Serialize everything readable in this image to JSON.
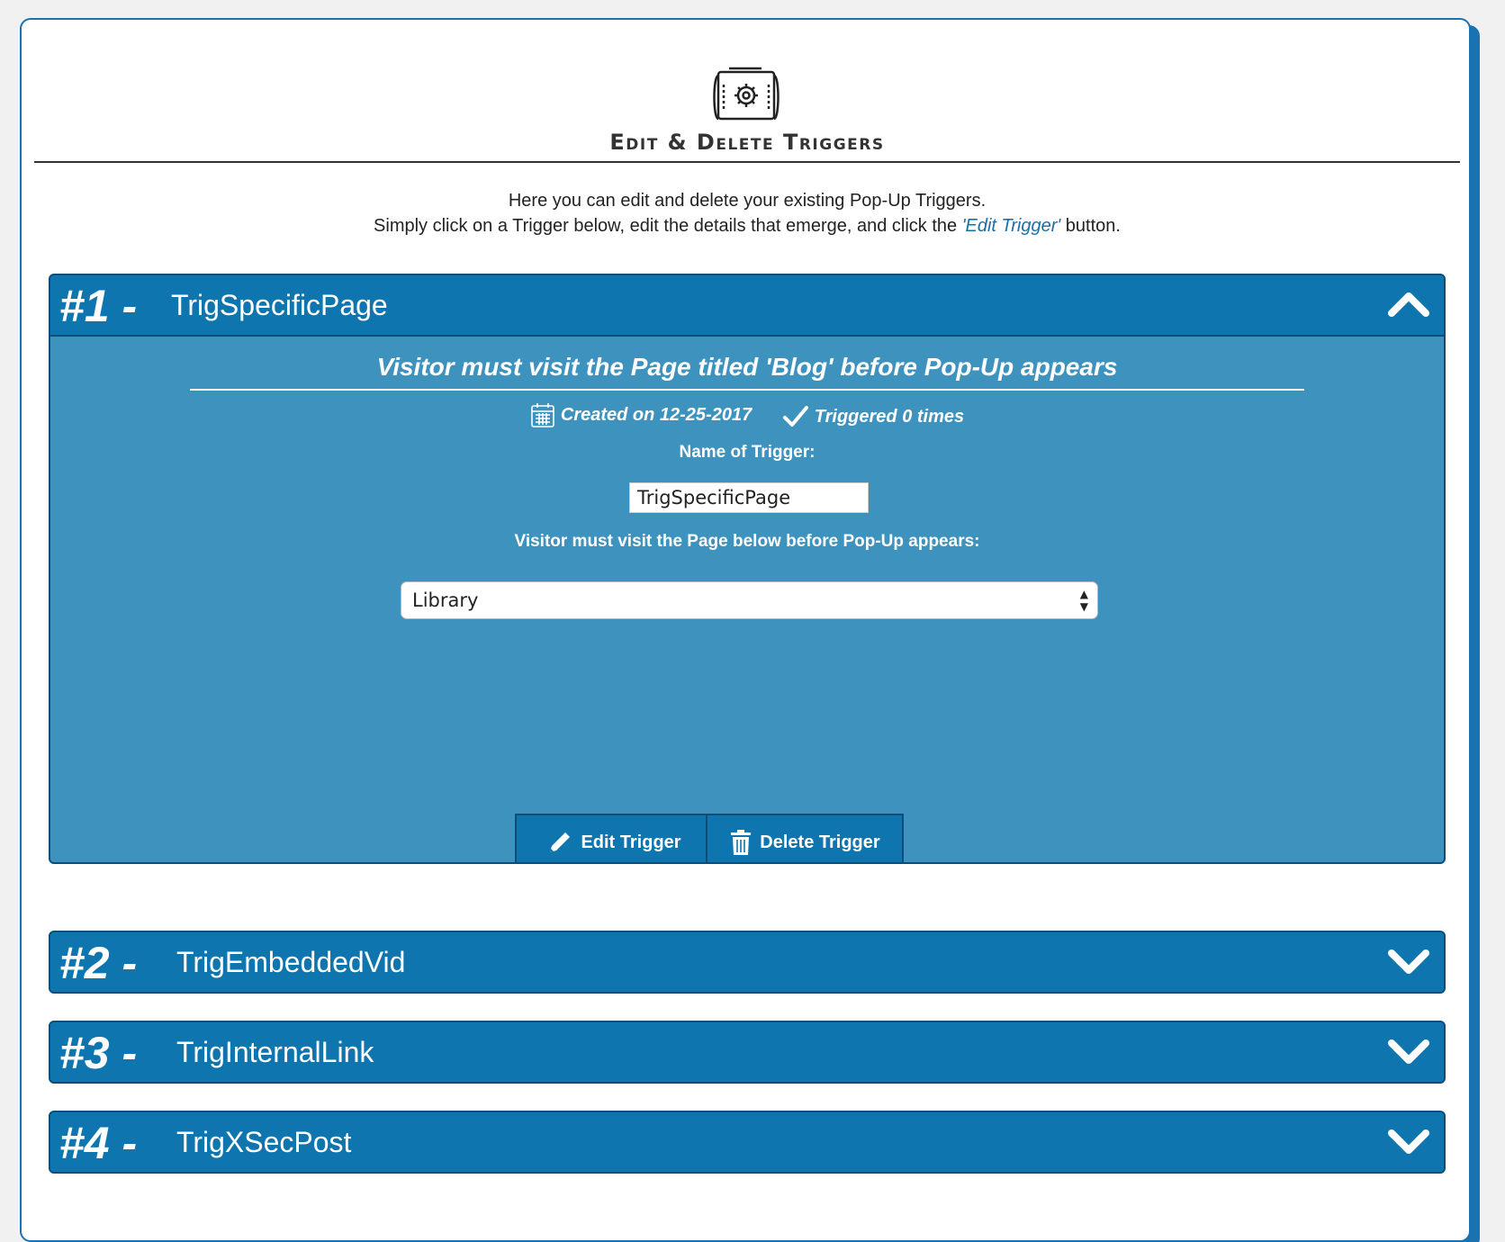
{
  "page": {
    "title": "Edit & Delete Triggers",
    "intro_line1": "Here you can edit and delete your existing Pop-Up Triggers.",
    "intro_line2_pre": "Simply click on a Trigger below, edit the details that emerge, and click the ",
    "intro_line2_em": "'Edit Trigger'",
    "intro_line2_post": " button."
  },
  "triggers": [
    {
      "number": "#1 -",
      "name": "TrigSpecificPage",
      "expanded": true,
      "description": "Visitor must visit the Page titled 'Blog' before Pop-Up appears",
      "created": "Created on 12-25-2017",
      "triggered": "Triggered 0 times",
      "name_label": "Name of Trigger:",
      "name_value": "TrigSpecificPage",
      "page_label": "Visitor must visit the Page below before Pop-Up appears:",
      "page_value": "Library",
      "edit_label": "Edit Trigger",
      "delete_label": "Delete Trigger"
    },
    {
      "number": "#2 -",
      "name": "TrigEmbeddedVid",
      "expanded": false
    },
    {
      "number": "#3 -",
      "name": "TrigInternalLink",
      "expanded": false
    },
    {
      "number": "#4 -",
      "name": "TrigXSecPost",
      "expanded": false
    }
  ],
  "icons": {
    "header": "blueprint-gear-icon",
    "expanded": "chevron-up-icon",
    "collapsed": "chevron-down-icon",
    "created": "calendar-icon",
    "triggered": "checkmark-icon",
    "edit": "pencil-icon",
    "delete": "trash-icon"
  },
  "colors": {
    "accent": "#0f75ae",
    "body": "#3e92be",
    "border": "#0c4d7a",
    "link": "#1a6fa8"
  }
}
